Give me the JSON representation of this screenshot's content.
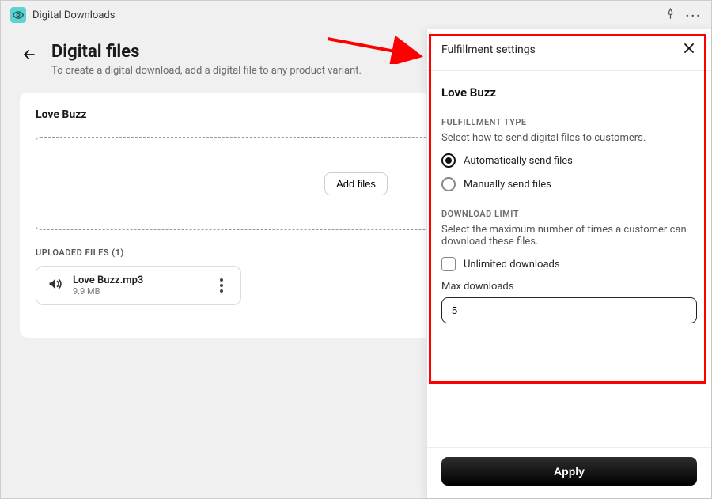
{
  "topbar": {
    "app_name": "Digital Downloads"
  },
  "page": {
    "title": "Digital files",
    "subtitle": "To create a digital download, add a digital file to any product variant."
  },
  "product": {
    "name": "Love Buzz"
  },
  "dropzone": {
    "add_files_label": "Add files"
  },
  "uploaded": {
    "heading": "UPLOADED FILES (1)",
    "files": [
      {
        "name": "Love Buzz.mp3",
        "size": "9.9 MB"
      }
    ]
  },
  "panel": {
    "title": "Fulfillment settings",
    "product_title": "Love Buzz",
    "fulfillment": {
      "label": "FULFILLMENT TYPE",
      "description": "Select how to send digital files to customers.",
      "options": {
        "auto": "Automatically send files",
        "manual": "Manually send files"
      }
    },
    "download_limit": {
      "label": "DOWNLOAD LIMIT",
      "description": "Select the maximum number of times a customer can download these files.",
      "unlimited_label": "Unlimited downloads",
      "max_label": "Max downloads",
      "max_value": "5"
    },
    "apply_label": "Apply"
  }
}
